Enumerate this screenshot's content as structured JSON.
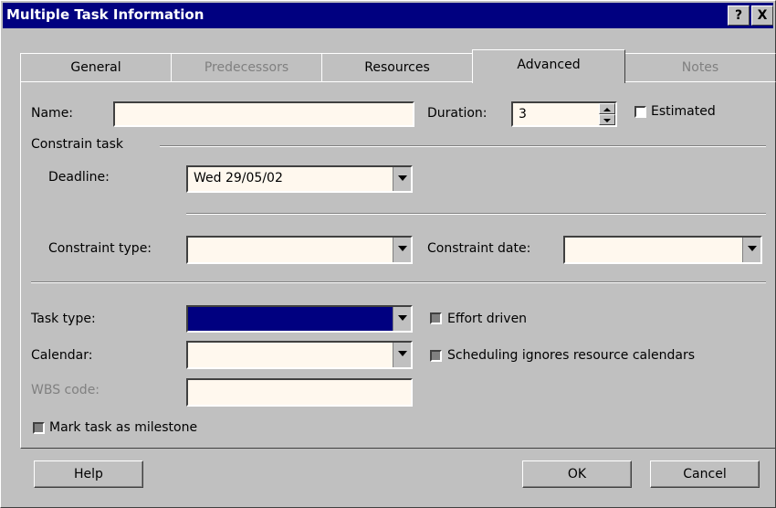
{
  "window": {
    "title": "Multiple Task Information",
    "help_button": "?",
    "close_button": "X"
  },
  "tabs": [
    {
      "label": "General",
      "state": "enabled"
    },
    {
      "label": "Predecessors",
      "state": "disabled"
    },
    {
      "label": "Resources",
      "state": "enabled"
    },
    {
      "label": "Advanced",
      "state": "active"
    },
    {
      "label": "Notes",
      "state": "disabled"
    }
  ],
  "fields": {
    "name_label": "Name:",
    "name_value": "",
    "duration_label": "Duration:",
    "duration_value": "3",
    "estimated_label": "Estimated"
  },
  "constrain_task": {
    "group_label": "Constrain task",
    "deadline_label": "Deadline:",
    "deadline_value": "Wed 29/05/02",
    "constraint_type_label": "Constraint type:",
    "constraint_type_value": "",
    "constraint_date_label": "Constraint date:",
    "constraint_date_value": ""
  },
  "task": {
    "task_type_label": "Task type:",
    "effort_driven_label": "Effort driven",
    "calendar_label": "Calendar:",
    "calendar_value": "",
    "scheduling_label": "Scheduling ignores resource calendars",
    "wbs_label": "WBS code:",
    "wbs_value": "",
    "milestone_label": "Mark task as milestone"
  },
  "buttons": {
    "help": "Help",
    "ok": "OK",
    "cancel": "Cancel"
  },
  "colors": {
    "title_bar": "#000080",
    "field_bg": "#fff8ee",
    "selected": "#000080"
  }
}
